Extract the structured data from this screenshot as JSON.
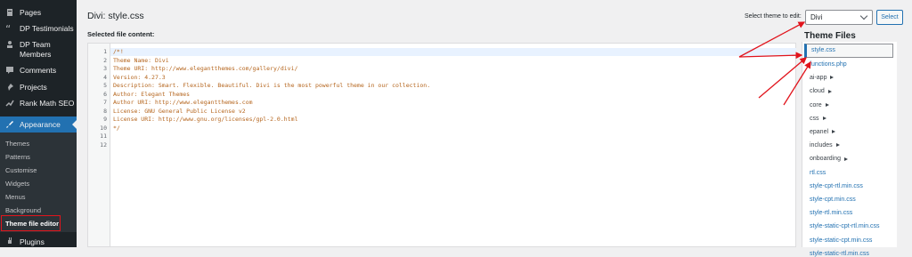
{
  "sidebar": {
    "items": [
      {
        "label": "Pages",
        "icon": "pages-icon"
      },
      {
        "label": "DP Testimonials",
        "icon": "quote-icon"
      },
      {
        "label": "DP Team Members",
        "icon": "team-icon"
      },
      {
        "label": "Comments",
        "icon": "comment-icon"
      },
      {
        "label": "Projects",
        "icon": "pin-icon"
      },
      {
        "label": "Rank Math SEO",
        "icon": "rankmath-icon"
      },
      {
        "label": "Appearance",
        "icon": "brush-icon"
      }
    ],
    "submenu": [
      "Themes",
      "Patterns",
      "Customise",
      "Widgets",
      "Menus",
      "Background",
      "Theme file editor"
    ],
    "plugins": {
      "label": "Plugins",
      "icon": "plug-icon"
    }
  },
  "main": {
    "title": "Divi: style.css",
    "selected_label": "Selected file content:",
    "theme_select_label": "Select theme to edit:",
    "theme_value": "Divi",
    "select_button": "Select",
    "line_numbers": [
      "1",
      "2",
      "3",
      "4",
      "5",
      "6",
      "7",
      "8",
      "9",
      "10",
      "11",
      "12"
    ],
    "code_lines": [
      "/*!",
      "Theme Name: Divi",
      "Theme URI: http://www.elegantthemes.com/gallery/divi/",
      "Version: 4.27.3",
      "Description: Smart. Flexible. Beautiful. Divi is the most powerful theme in our collection.",
      "Author: Elegant Themes",
      "Author URI: http://www.elegantthemes.com",
      "License: GNU General Public License v2",
      "License URI: http://www.gnu.org/licenses/gpl-2.0.html",
      "*/",
      "",
      ""
    ]
  },
  "files": {
    "title": "Theme Files",
    "current": "style.css",
    "entries": [
      {
        "label": "functions.php",
        "type": "file"
      },
      {
        "label": "ai-app",
        "type": "folder"
      },
      {
        "label": "cloud",
        "type": "folder"
      },
      {
        "label": "core",
        "type": "folder"
      },
      {
        "label": "css",
        "type": "folder"
      },
      {
        "label": "epanel",
        "type": "folder"
      },
      {
        "label": "includes",
        "type": "folder"
      },
      {
        "label": "onboarding",
        "type": "folder"
      },
      {
        "label": "rtl.css",
        "type": "file"
      },
      {
        "label": "style-cpt-rtl.min.css",
        "type": "file"
      },
      {
        "label": "style-cpt.min.css",
        "type": "file"
      },
      {
        "label": "style-rtl.min.css",
        "type": "file"
      },
      {
        "label": "style-static-cpt-rtl.min.css",
        "type": "file"
      },
      {
        "label": "style-static-cpt.min.css",
        "type": "file"
      },
      {
        "label": "style-static-rtl.min.css",
        "type": "file"
      }
    ]
  },
  "colors": {
    "accent": "#2271b1",
    "sidebar_bg": "#1d2327",
    "highlight": "#e1141c"
  }
}
